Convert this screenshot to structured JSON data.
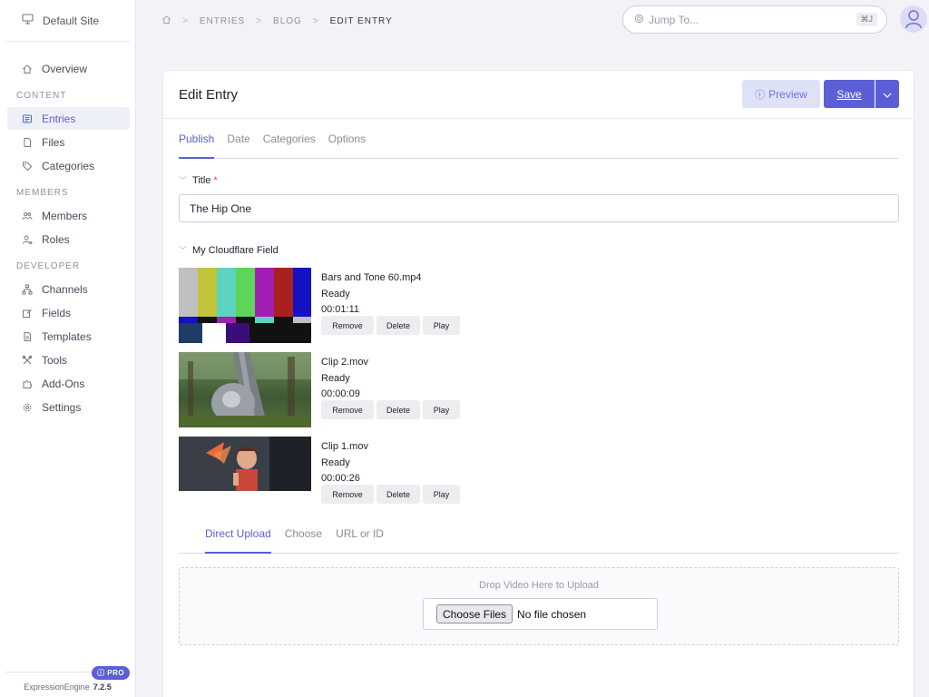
{
  "sidebar": {
    "site_name": "Default Site",
    "overview": "Overview",
    "sections": {
      "content": "CONTENT",
      "members": "MEMBERS",
      "developer": "DEVELOPER"
    },
    "items": {
      "entries": "Entries",
      "files": "Files",
      "categories": "Categories",
      "members": "Members",
      "roles": "Roles",
      "channels": "Channels",
      "fields": "Fields",
      "templates": "Templates",
      "tools": "Tools",
      "addons": "Add-Ons",
      "settings": "Settings"
    },
    "footer": {
      "product": "ExpressionEngine",
      "version": "7.2.5",
      "badge": "PRO"
    }
  },
  "breadcrumb": {
    "entries": "ENTRIES",
    "blog": "BLOG",
    "current": "EDIT ENTRY"
  },
  "jump": {
    "placeholder": "Jump To...",
    "shortcut": "⌘J"
  },
  "panel": {
    "title": "Edit Entry",
    "preview_label": "Preview",
    "save_label": "Save"
  },
  "tabs": [
    "Publish",
    "Date",
    "Categories",
    "Options"
  ],
  "title_field": {
    "label": "Title",
    "required_mark": "*",
    "value": "The Hip One"
  },
  "cloudflare_field": {
    "label": "My Cloudflare Field",
    "videos": [
      {
        "name": "Bars and Tone 60.mp4",
        "status": "Ready",
        "duration": "00:01:11"
      },
      {
        "name": "Clip 2.mov",
        "status": "Ready",
        "duration": "00:00:09"
      },
      {
        "name": "Clip 1.mov",
        "status": "Ready",
        "duration": "00:00:26"
      }
    ],
    "actions": {
      "remove": "Remove",
      "delete": "Delete",
      "play": "Play"
    },
    "upload_tabs": [
      "Direct Upload",
      "Choose",
      "URL or ID"
    ],
    "drop_text": "Drop Video Here to Upload",
    "file_button": "Choose Files",
    "file_status": "No file chosen"
  },
  "colors": {
    "accent": "#5b5fd6",
    "accent_light": "#dfe1f7",
    "required": "#e0453a"
  }
}
